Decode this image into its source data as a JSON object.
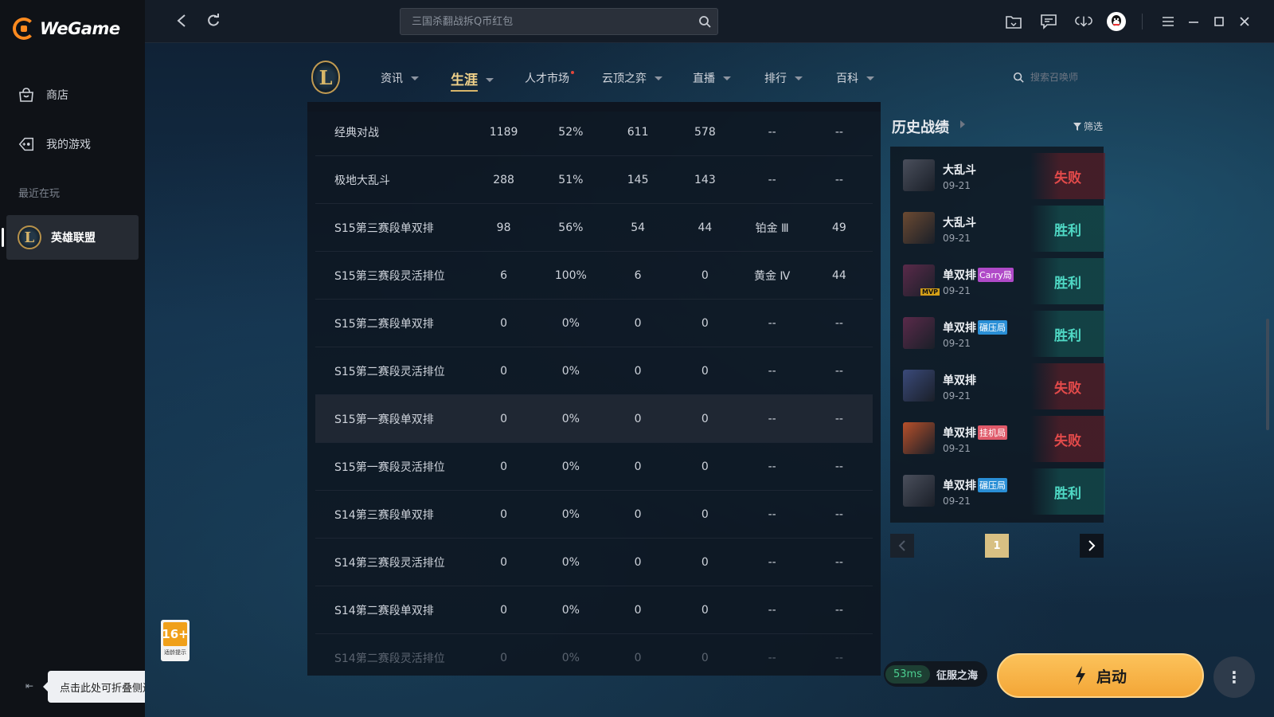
{
  "app": {
    "name": "WeGame"
  },
  "sidebar": {
    "items": [
      {
        "label": "商店",
        "icon": "shop-icon"
      },
      {
        "label": "我的游戏",
        "icon": "gamepad-icon"
      }
    ],
    "recent_label": "最近在玩",
    "recent_game": "英雄联盟",
    "collapse_tooltip": "点击此处可折叠侧边栏",
    "age_rating": "16+",
    "age_note": "适龄提示"
  },
  "topbar": {
    "search_placeholder": "三国杀翻战拆Q币红包"
  },
  "game_nav": {
    "items": [
      {
        "label": "资讯"
      },
      {
        "label": "生涯"
      },
      {
        "label": "人才市场"
      },
      {
        "label": "云顶之弈"
      },
      {
        "label": "直播"
      },
      {
        "label": "排行"
      },
      {
        "label": "百科"
      }
    ],
    "active": "生涯",
    "summoner_search_placeholder": "搜索召唤师"
  },
  "stats": {
    "rows": [
      {
        "mode": "经典对战",
        "games": "1189",
        "winrate": "52%",
        "wins": "611",
        "losses": "578",
        "rank": "--",
        "points": "--"
      },
      {
        "mode": "极地大乱斗",
        "games": "288",
        "winrate": "51%",
        "wins": "145",
        "losses": "143",
        "rank": "--",
        "points": "--"
      },
      {
        "mode": "S15第三赛段单双排",
        "games": "98",
        "winrate": "56%",
        "wins": "54",
        "losses": "44",
        "rank": "铂金 Ⅲ",
        "points": "49"
      },
      {
        "mode": "S15第三赛段灵活排位",
        "games": "6",
        "winrate": "100%",
        "wins": "6",
        "losses": "0",
        "rank": "黄金 Ⅳ",
        "points": "44"
      },
      {
        "mode": "S15第二赛段单双排",
        "games": "0",
        "winrate": "0%",
        "wins": "0",
        "losses": "0",
        "rank": "--",
        "points": "--"
      },
      {
        "mode": "S15第二赛段灵活排位",
        "games": "0",
        "winrate": "0%",
        "wins": "0",
        "losses": "0",
        "rank": "--",
        "points": "--"
      },
      {
        "mode": "S15第一赛段单双排",
        "games": "0",
        "winrate": "0%",
        "wins": "0",
        "losses": "0",
        "rank": "--",
        "points": "--"
      },
      {
        "mode": "S15第一赛段灵活排位",
        "games": "0",
        "winrate": "0%",
        "wins": "0",
        "losses": "0",
        "rank": "--",
        "points": "--"
      },
      {
        "mode": "S14第三赛段单双排",
        "games": "0",
        "winrate": "0%",
        "wins": "0",
        "losses": "0",
        "rank": "--",
        "points": "--"
      },
      {
        "mode": "S14第三赛段灵活排位",
        "games": "0",
        "winrate": "0%",
        "wins": "0",
        "losses": "0",
        "rank": "--",
        "points": "--"
      },
      {
        "mode": "S14第二赛段单双排",
        "games": "0",
        "winrate": "0%",
        "wins": "0",
        "losses": "0",
        "rank": "--",
        "points": "--"
      },
      {
        "mode": "S14第二赛段灵活排位",
        "games": "0",
        "winrate": "0%",
        "wins": "0",
        "losses": "0",
        "rank": "--",
        "points": "--"
      }
    ]
  },
  "history": {
    "title": "历史战绩",
    "filter_label": "筛选",
    "matches": [
      {
        "mode": "大乱斗",
        "date": "09-21",
        "result": "失败",
        "win": false,
        "tag": "",
        "mvp": false,
        "champ_color": "#4a4f5c"
      },
      {
        "mode": "大乱斗",
        "date": "09-21",
        "result": "胜利",
        "win": true,
        "tag": "",
        "mvp": false,
        "champ_color": "#6b4a32"
      },
      {
        "mode": "单双排",
        "date": "09-21",
        "result": "胜利",
        "win": true,
        "tag": "Carry局",
        "tag_color": "#b04ac8",
        "mvp": true,
        "mvp_label": "MVP",
        "champ_color": "#5a2a4a"
      },
      {
        "mode": "单双排",
        "date": "09-21",
        "result": "胜利",
        "win": true,
        "tag": "碾压局",
        "tag_color": "#2a8fd6",
        "mvp": false,
        "champ_color": "#5a2a4a"
      },
      {
        "mode": "单双排",
        "date": "09-21",
        "result": "失败",
        "win": false,
        "tag": "",
        "mvp": false,
        "champ_color": "#3a4a7a"
      },
      {
        "mode": "单双排",
        "date": "09-21",
        "result": "失败",
        "win": false,
        "tag": "挂机局",
        "tag_color": "#e05a6a",
        "mvp": false,
        "champ_color": "#b8502a"
      },
      {
        "mode": "单双排",
        "date": "09-21",
        "result": "胜利",
        "win": true,
        "tag": "碾压局",
        "tag_color": "#2a8fd6",
        "mvp": false,
        "champ_color": "#4a4f5c"
      }
    ],
    "page": "1"
  },
  "bottom": {
    "ping": "53ms",
    "server": "征服之海",
    "launch_label": "启动"
  }
}
